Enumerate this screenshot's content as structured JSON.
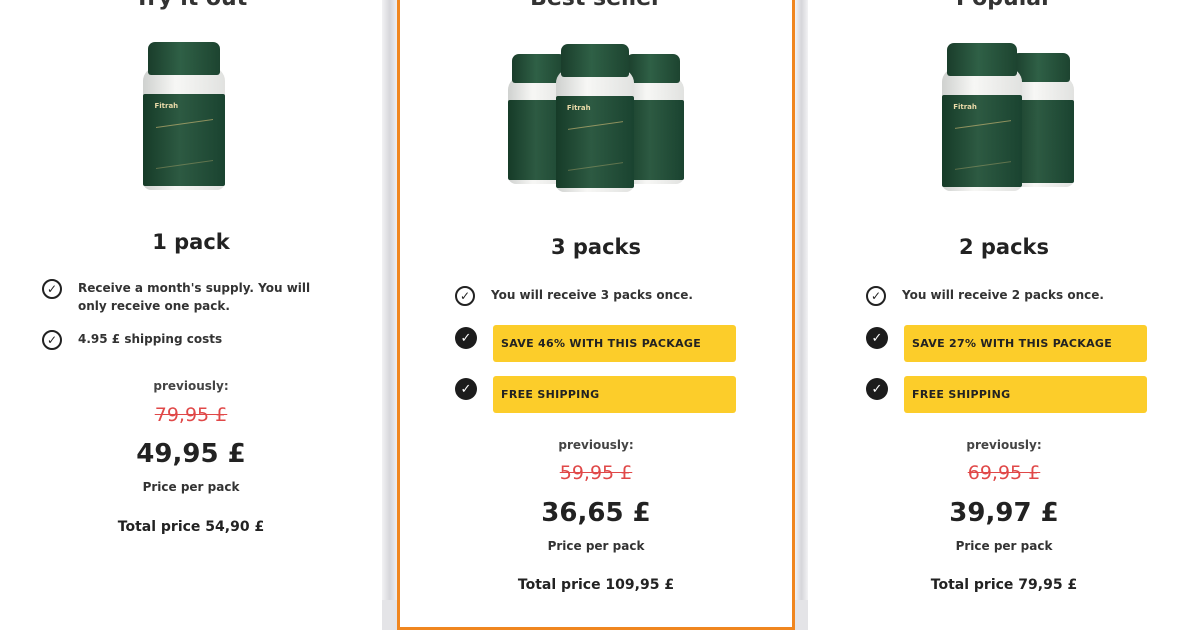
{
  "offers": [
    {
      "top_text": "Try it out",
      "pack_title": "1 pack",
      "features": [
        {
          "type": "outline",
          "text": "Receive a month's supply. You will only receive one pack."
        },
        {
          "type": "outline",
          "text": "4.95 £ shipping costs"
        }
      ],
      "badges": [],
      "previously_label": "previously:",
      "old_price": "79,95 £",
      "new_price": "49,95 £",
      "per_pack_label": "Price per pack",
      "total_price": "Total price 54,90 £"
    },
    {
      "top_text": "Best seller",
      "pack_title": "3 packs",
      "features": [
        {
          "type": "outline",
          "text": "You will receive 3 packs once."
        }
      ],
      "badges": [
        "SAVE 46% WITH THIS PACKAGE",
        "FREE SHIPPING"
      ],
      "previously_label": "previously:",
      "old_price": "59,95 £",
      "new_price": "36,65 £",
      "per_pack_label": "Price per pack",
      "total_price": "Total price 109,95 £"
    },
    {
      "top_text": "Popular",
      "pack_title": "2 packs",
      "features": [
        {
          "type": "outline",
          "text": "You will receive 2 packs once."
        }
      ],
      "badges": [
        "SAVE 27% WITH THIS PACKAGE",
        "FREE SHIPPING"
      ],
      "previously_label": "previously:",
      "old_price": "69,95 £",
      "new_price": "39,97 £",
      "per_pack_label": "Price per pack",
      "total_price": "Total price 79,95 £"
    }
  ],
  "product": {
    "brand": "Fitrah",
    "label_text": "Metabolism Support Formula",
    "bottle_icon": "supplement-bottle-icon"
  },
  "colors": {
    "accent_border": "#f0861f",
    "badge_yellow": "#fccd2a",
    "old_price_red": "#e04848",
    "bottle_green": "#1f4a33"
  }
}
